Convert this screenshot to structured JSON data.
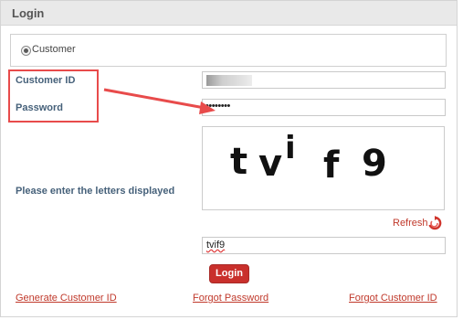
{
  "header": {
    "title": "Login"
  },
  "user_type": {
    "selected": true,
    "label": "Customer"
  },
  "form": {
    "customer_id_label": "Customer ID",
    "password_label": "Password",
    "password_value": "••••••••",
    "captcha_label": "Please enter the letters displayed",
    "captcha_chars": [
      "t",
      "v",
      "i",
      "f",
      "9"
    ],
    "refresh_label": "Refresh",
    "captcha_input_value": "tvif9",
    "login_label": "Login"
  },
  "links": {
    "generate_id": "Generate Customer ID",
    "forgot_password": "Forgot Password",
    "forgot_customer_id": "Forgot Customer ID"
  },
  "annotation": {
    "color": "#e84b4b"
  },
  "colors": {
    "accent": "#c9302c",
    "label": "#46617a"
  }
}
